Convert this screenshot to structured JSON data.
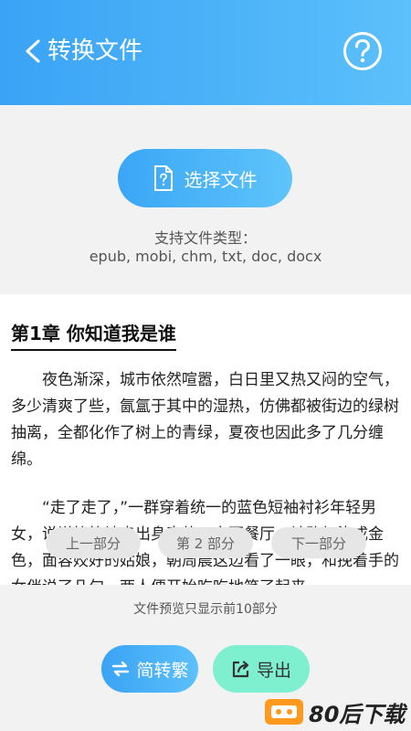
{
  "header": {
    "title": "转换文件"
  },
  "upload": {
    "select_label": "选择文件",
    "types_label": "支持文件类型：",
    "types_value": "epub, mobi, chm, txt, doc, docx"
  },
  "preview": {
    "chapter_title": "第1章 你知道我是谁",
    "paragraph1": "　　夜色渐深，城市依然喧嚣，白日里又热又闷的空气，多少清爽了些，氤氲于其中的湿热，仿佛都被街边的绿树抽离，全都化作了树上的青绿，夏夜也因此多了几分缠绵。",
    "paragraph2": "　　“走了走了，”一群穿着统一的蓝色短袖衬衫年轻男女，说说笑笑地走出身旁的一家西餐厅，被路灯染成金色，面容姣好的姑娘，朝周晨这边看了一眼，和挽着手的女伴说了几句，两人便开始吃吃地笑了起来。"
  },
  "segments": {
    "prev": "上一部分",
    "current": "第 2 部分",
    "next": "下一部分"
  },
  "bottom": {
    "notice": "文件预览只显示前10部分",
    "convert_label": "简转繁",
    "export_label": "导出"
  },
  "watermark": {
    "text": "80后下载"
  },
  "colors": {
    "accent": "#3aa3f5",
    "export": "#7ef0d0",
    "logo": "#ff9a1e"
  }
}
